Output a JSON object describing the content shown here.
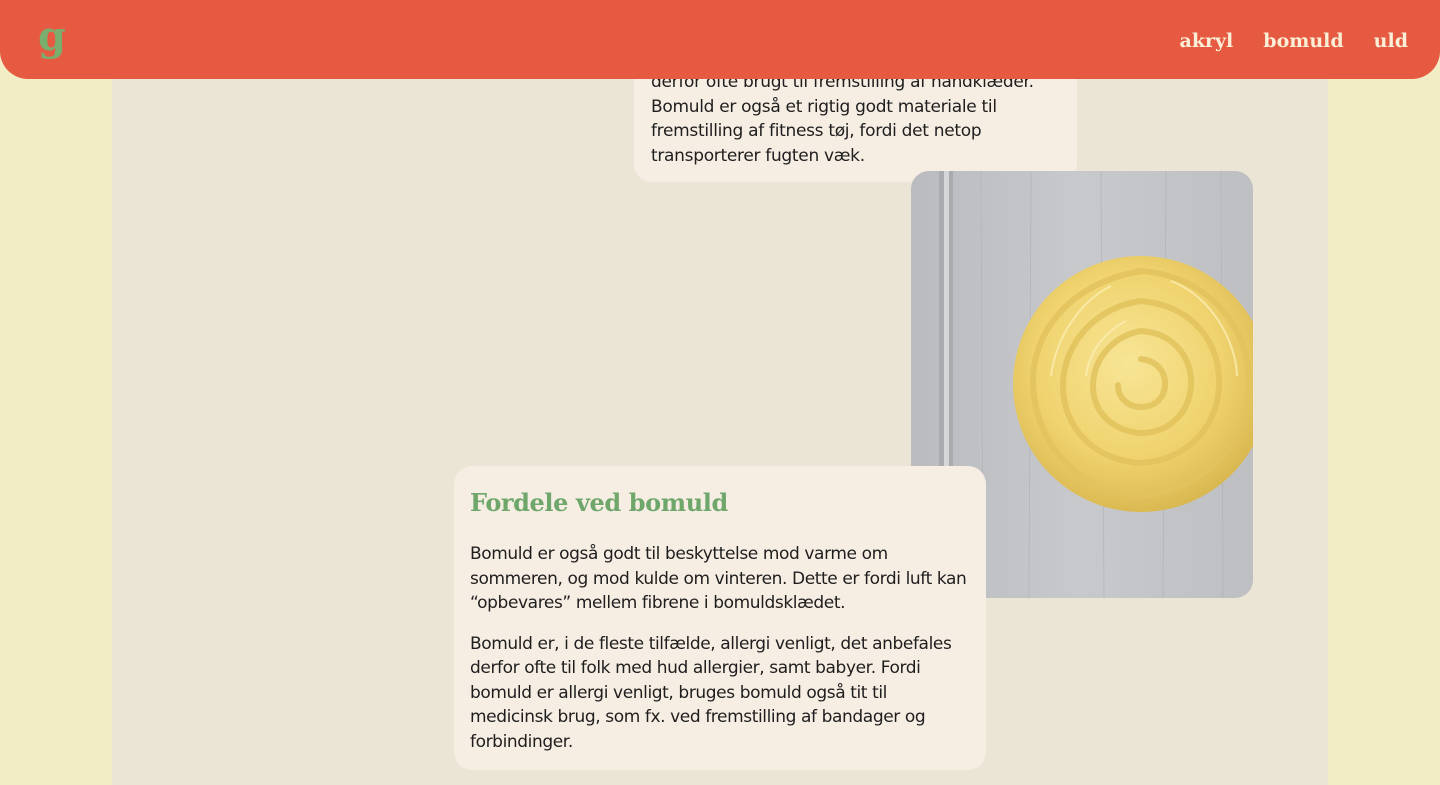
{
  "header": {
    "logo_text": "g",
    "nav": [
      {
        "label": "akryl"
      },
      {
        "label": "bomuld"
      },
      {
        "label": "uld"
      }
    ]
  },
  "top_card": {
    "lines": [
      "derfor ofte brugt til fremstilling af håndklæder.",
      "Bomuld er også et rigtig godt materiale til",
      "fremstilling af fitness tøj, fordi det netop",
      "transporterer fugten væk."
    ]
  },
  "yarn_image": {
    "alt": "gul bomuldsgarn nøgle"
  },
  "benefits_card": {
    "heading": "Fordele ved bomuld",
    "paragraphs": [
      "Bomuld er også godt til beskyttelse mod varme om sommeren, og mod kulde om vinteren. Dette er fordi luft kan “opbevares” mellem fibrene i bomuldsklædet.",
      "Bomuld er, i de fleste tilfælde, allergi venligt, det anbefales derfor ofte til folk med hud allergier, samt babyer. Fordi bomuld er allergi venligt, bruges bomuld også tit til medicinsk brug, som fx. ved fremstilling af bandager og forbindinger."
    ]
  },
  "colors": {
    "header": "#e65a42",
    "logo": "#7aae6e",
    "nav_text": "#fbefd7",
    "page_bg": "#f3edc6",
    "content_bg": "#ebe5d6",
    "card_bg": "#f6ede3",
    "heading": "#6fa76b",
    "yarn": "#f1d574"
  }
}
